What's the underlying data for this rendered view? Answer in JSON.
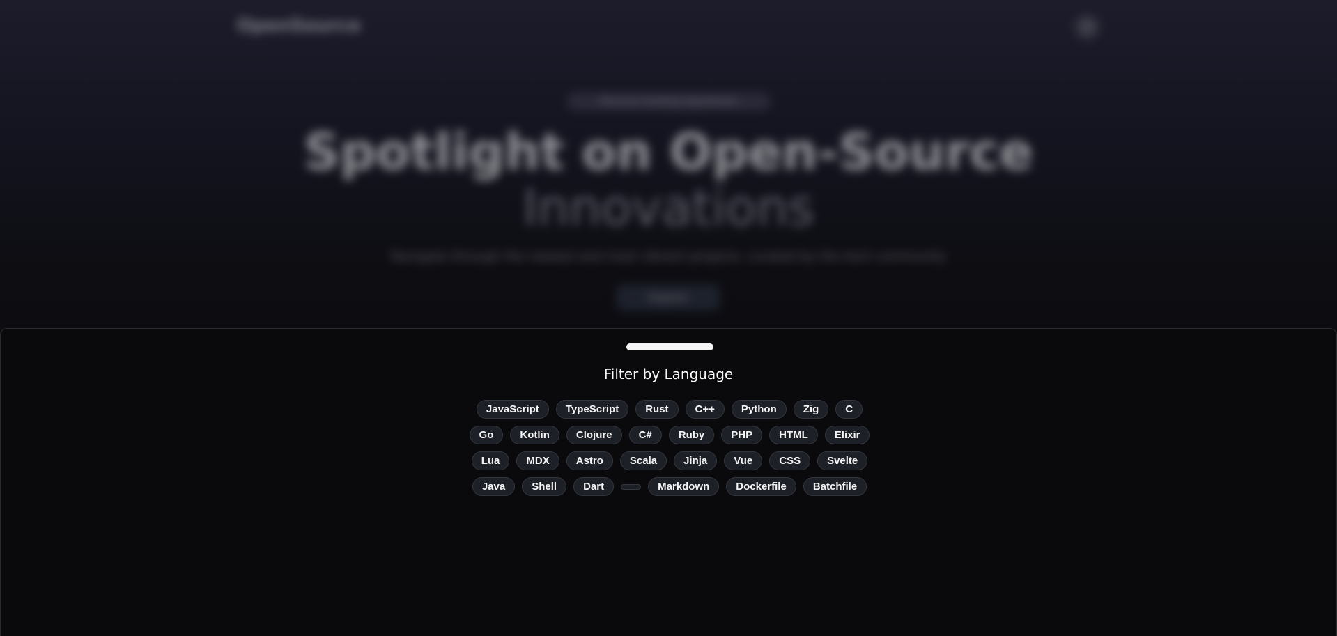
{
  "header": {
    "brand": "OpenSource",
    "search_icon": "search-icon"
  },
  "hero": {
    "badge": "Discover trending repositories",
    "title_line1": "Spotlight on Open-Source",
    "title_line2": "Innovations",
    "subtitle": "Navigate through the newest and most vibrant projects, curated by the tech community",
    "cta": "Explore"
  },
  "drawer": {
    "title": "Filter by Language",
    "rows": [
      [
        "JavaScript",
        "TypeScript",
        "Rust",
        "C++",
        "Python",
        "Zig",
        "C"
      ],
      [
        "Go",
        "Kotlin",
        "Clojure",
        "C#",
        "Ruby",
        "PHP",
        "HTML",
        "Elixir"
      ],
      [
        "Lua",
        "MDX",
        "Astro",
        "Scala",
        "Jinja",
        "Vue",
        "CSS",
        "Svelte"
      ],
      [
        "Java",
        "Shell",
        "Dart",
        "",
        "Markdown",
        "Dockerfile",
        "Batchfile"
      ]
    ]
  }
}
